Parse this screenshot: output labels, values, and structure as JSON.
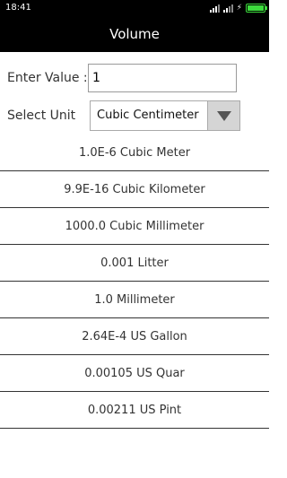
{
  "status_bar": {
    "time": "18:41",
    "icons": [
      "signal-icon",
      "signal-icon",
      "charging-icon",
      "battery-icon"
    ],
    "battery_color": "#3ddc3d"
  },
  "app": {
    "title": "Volume"
  },
  "form": {
    "value_label": "Enter Value :",
    "value": "1",
    "unit_label": "Select Unit",
    "unit_selected": "Cubic Centimeter"
  },
  "results": [
    "1.0E-6 Cubic Meter",
    "9.9E-16 Cubic Kilometer",
    "1000.0 Cubic Millimeter",
    "0.001 Litter",
    "1.0 Millimeter",
    "2.64E-4 US Gallon",
    "0.00105 US Quar",
    "0.00211 US Pint"
  ]
}
